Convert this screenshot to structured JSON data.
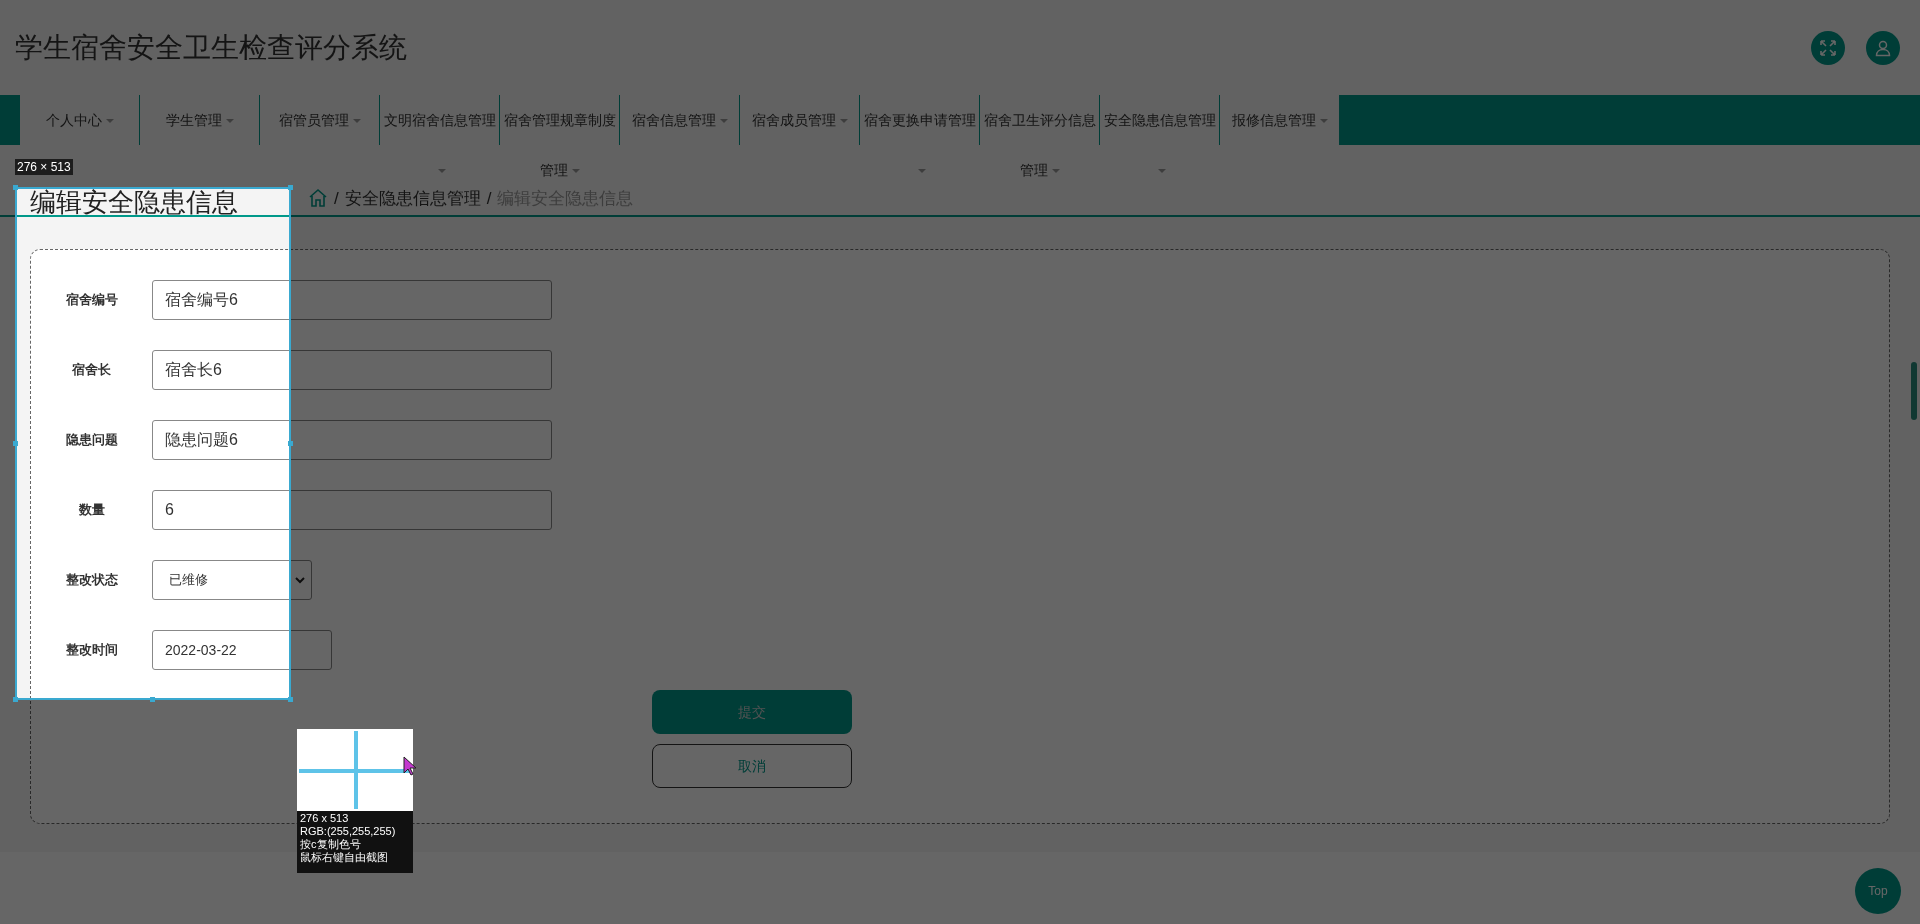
{
  "header": {
    "title": "学生宿舍安全卫生检查评分系统"
  },
  "nav": {
    "items": [
      {
        "label": "个人中心"
      },
      {
        "label": "学生管理"
      },
      {
        "label": "宿管员管理"
      },
      {
        "label": "文明宿舍信息管理"
      },
      {
        "label": "宿舍管理规章制度管理"
      },
      {
        "label": "宿舍信息管理"
      },
      {
        "label": "宿舍成员管理"
      },
      {
        "label": "宿舍更换申请管理"
      },
      {
        "label": "宿舍卫生评分信息管理"
      },
      {
        "label": "安全隐患信息管理"
      },
      {
        "label": "报修信息管理"
      }
    ]
  },
  "page": {
    "title": "编辑安全隐患信息",
    "breadcrumb": [
      "安全隐患信息管理",
      "编辑安全隐患信息"
    ],
    "breadcrumb_separator": "/"
  },
  "form": {
    "fields": [
      {
        "kind": "input",
        "label": "宿舍编号",
        "value": "宿舍编号6"
      },
      {
        "kind": "input",
        "label": "宿舍长",
        "value": "宿舍长6"
      },
      {
        "kind": "input",
        "label": "隐患问题",
        "value": "隐患问题6"
      },
      {
        "kind": "input",
        "label": "数量",
        "value": "6"
      },
      {
        "kind": "select",
        "label": "整改状态",
        "value": "已维修"
      },
      {
        "kind": "date",
        "label": "整改时间",
        "value": "2022-03-22"
      }
    ],
    "buttons": [
      {
        "kind": "primary",
        "label": "提交"
      },
      {
        "kind": "outline",
        "label": "取消"
      }
    ]
  },
  "back_to_top": "Top",
  "capture_overlay": {
    "size_label": "276 × 513",
    "info": [
      "276 x 513",
      "RGB:(255,255,255)",
      "按c复制色号",
      "鼠标右键自由截图"
    ]
  }
}
